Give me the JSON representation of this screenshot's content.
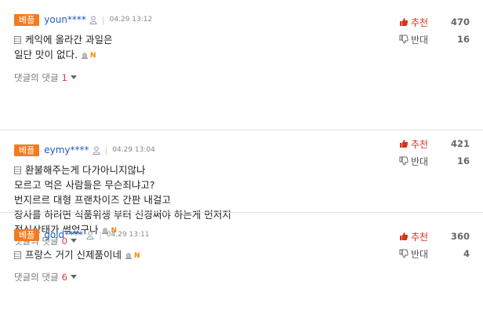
{
  "comments": [
    {
      "badge": "베플",
      "username": "youn****",
      "date": "04.29 13:12",
      "lines": [
        "케익에 올라간 과일은",
        "일단 맛이 없다."
      ],
      "reply_label": "댓글의 댓글",
      "reply_count": "1",
      "like_label": "추천",
      "like_count": "470",
      "dislike_label": "반대",
      "dislike_count": "16"
    },
    {
      "badge": "베플",
      "username": "eymy****",
      "date": "04.29 13:04",
      "lines": [
        "환불해주는게 다가아니지않나",
        "모르고 먹은 사람들은 무슨죄냐고?",
        "번지르르 대형 프랜차이즈 간판 내걸고",
        "장사를 하려면 식품위생 부터 신경써야 하는게 먼저지",
        "정신상태가 썩었구나"
      ],
      "reply_label": "댓글의 댓글",
      "reply_count": "0",
      "like_label": "추천",
      "like_count": "421",
      "dislike_label": "반대",
      "dislike_count": "16"
    },
    {
      "badge": "베플",
      "username": "gold****",
      "date": "04.29 13:11",
      "lines": [
        "프랑스 거기 신제품이네"
      ],
      "reply_label": "댓글의 댓글",
      "reply_count": "6",
      "like_label": "추천",
      "like_count": "360",
      "dislike_label": "반대",
      "dislike_count": "4"
    }
  ],
  "new_marker": "N",
  "colors": {
    "badge": "#f47a20",
    "username": "#1f5bbf",
    "like": "#d4351c",
    "reply_count": "#e03c31"
  }
}
